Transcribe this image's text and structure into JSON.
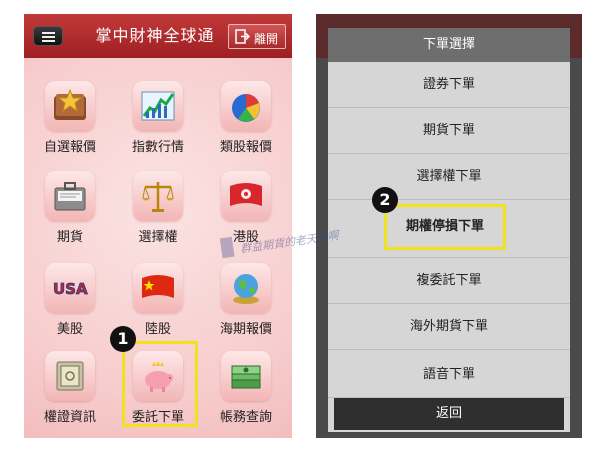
{
  "left_screen": {
    "title": "掌中財神全球通",
    "leave_label": "離開",
    "tiles": [
      {
        "label": "自選報價",
        "icon": "folder-star-icon"
      },
      {
        "label": "指數行情",
        "icon": "stock-chart-icon"
      },
      {
        "label": "類股報價",
        "icon": "pie-chart-icon"
      },
      {
        "label": "期貨",
        "icon": "briefcase-icon"
      },
      {
        "label": "選擇權",
        "icon": "balance-scale-icon"
      },
      {
        "label": "港股",
        "icon": "hong-kong-flag-icon"
      },
      {
        "label": "美股",
        "icon": "usa-text-icon"
      },
      {
        "label": "陸股",
        "icon": "china-flag-icon"
      },
      {
        "label": "海期報價",
        "icon": "globe-icon"
      },
      {
        "label": "權證資訊",
        "icon": "safe-icon"
      },
      {
        "label": "委託下單",
        "icon": "piggy-bank-icon"
      },
      {
        "label": "帳務查詢",
        "icon": "money-stack-icon"
      }
    ],
    "step_badge": "1"
  },
  "right_screen": {
    "dialog_title": "下單選擇",
    "items": [
      "證券下單",
      "期貨下單",
      "選擇權下單",
      "期權停損下單",
      "複委託下單",
      "海外期貨下單",
      "語音下單"
    ],
    "back_label": "返回",
    "step_badge": "2"
  },
  "watermark": {
    "text": "群益期貨的老天鵝啊"
  },
  "colors": {
    "header_red": "#b02a2d",
    "highlight_yellow": "#f2e21b",
    "tile_pink": "#f3b6b6",
    "dialog_gray": "#d6d6d6"
  }
}
